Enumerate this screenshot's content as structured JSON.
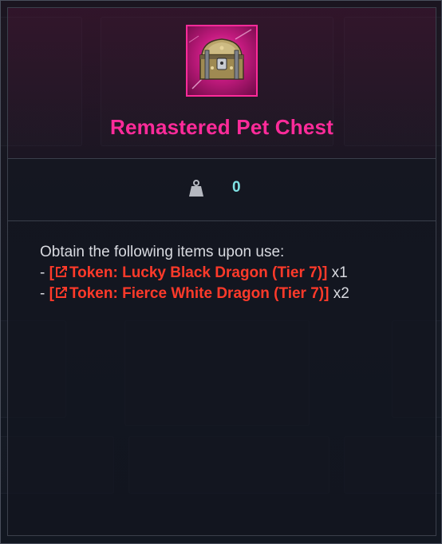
{
  "item": {
    "name": "Remastered Pet Chest",
    "rarity_color": "#ff2b9a",
    "icon": "treasure-chest-icon"
  },
  "stats": {
    "weight_icon": "weight-icon",
    "weight_value": "0"
  },
  "description": {
    "intro": "Obtain the following items upon use:",
    "rewards": [
      {
        "prefix": "- ",
        "open_bracket": "[",
        "link_icon": "external-link-icon",
        "name": "Token: Lucky Black Dragon (Tier 7)",
        "close_bracket": "]",
        "quantity": " x1"
      },
      {
        "prefix": "- ",
        "open_bracket": "[",
        "link_icon": "external-link-icon",
        "name": "Token: Fierce White Dragon (Tier 7)",
        "close_bracket": "]",
        "quantity": " x2"
      }
    ],
    "link_color": "#ff3a2a"
  }
}
